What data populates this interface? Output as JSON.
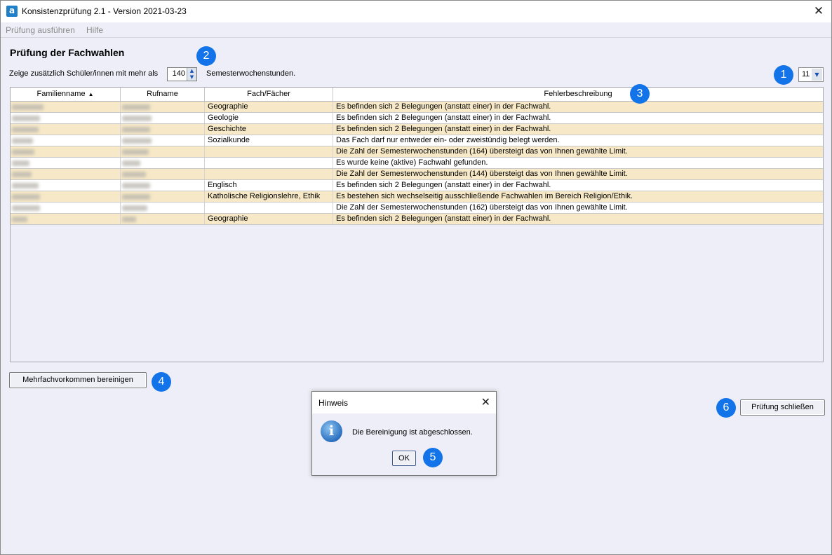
{
  "window": {
    "app_icon": "a",
    "title": "Konsistenzprüfung 2.1 - Version 2021-03-23",
    "close_glyph": "✕"
  },
  "menu": [
    "Prüfung ausführen",
    "Hilfe"
  ],
  "heading": "Prüfung der Fachwahlen",
  "filter": {
    "label": "Zeige zusätzlich Schüler/innen mit mehr als",
    "value": "140",
    "suffix": "Semesterwochenstunden."
  },
  "count_select": {
    "value": "11"
  },
  "badges": [
    "1",
    "2",
    "3",
    "4",
    "5",
    "6"
  ],
  "table": {
    "columns": [
      "Familienname",
      "Rufname",
      "Fach/Fächer",
      "Fehlerbeschreibung"
    ],
    "sorted_column": "Familienname",
    "sort_icon": "▲",
    "rows": [
      {
        "fach": "Geographie",
        "fehler": "Es befinden sich 2 Belegungen (anstatt einer) in der Fachwahl."
      },
      {
        "fach": "Geologie",
        "fehler": "Es befinden sich 2 Belegungen (anstatt einer) in der Fachwahl."
      },
      {
        "fach": "Geschichte",
        "fehler": "Es befinden sich 2 Belegungen (anstatt einer) in der Fachwahl."
      },
      {
        "fach": "Sozialkunde",
        "fehler": "Das Fach darf nur entweder ein- oder zweistündig belegt werden."
      },
      {
        "fach": "",
        "fehler": "Die Zahl der Semesterwochenstunden (164) übersteigt das von Ihnen gewählte Limit."
      },
      {
        "fach": "",
        "fehler": "Es wurde keine (aktive) Fachwahl gefunden."
      },
      {
        "fach": "",
        "fehler": "Die Zahl der Semesterwochenstunden (144) übersteigt das von Ihnen gewählte Limit."
      },
      {
        "fach": "Englisch",
        "fehler": "Es befinden sich 2 Belegungen (anstatt einer) in der Fachwahl."
      },
      {
        "fach": "Katholische Religionslehre, Ethik",
        "fehler": "Es bestehen sich wechselseitig ausschließende Fachwahlen im Bereich Religion/Ethik."
      },
      {
        "fach": "",
        "fehler": "Die Zahl der Semesterwochenstunden (162) übersteigt das von Ihnen gewählte Limit."
      },
      {
        "fach": "Geographie",
        "fehler": "Es befinden sich 2 Belegungen (anstatt einer) in der Fachwahl."
      }
    ]
  },
  "buttons": {
    "cleanup": "Mehrfachvorkommen bereinigen",
    "close_check": "Prüfung schließen"
  },
  "dialog": {
    "title": "Hinweis",
    "close_glyph": "✕",
    "icon": "info-icon",
    "icon_glyph": "i",
    "message": "Die Bereinigung ist abgeschlossen.",
    "ok": "OK"
  }
}
